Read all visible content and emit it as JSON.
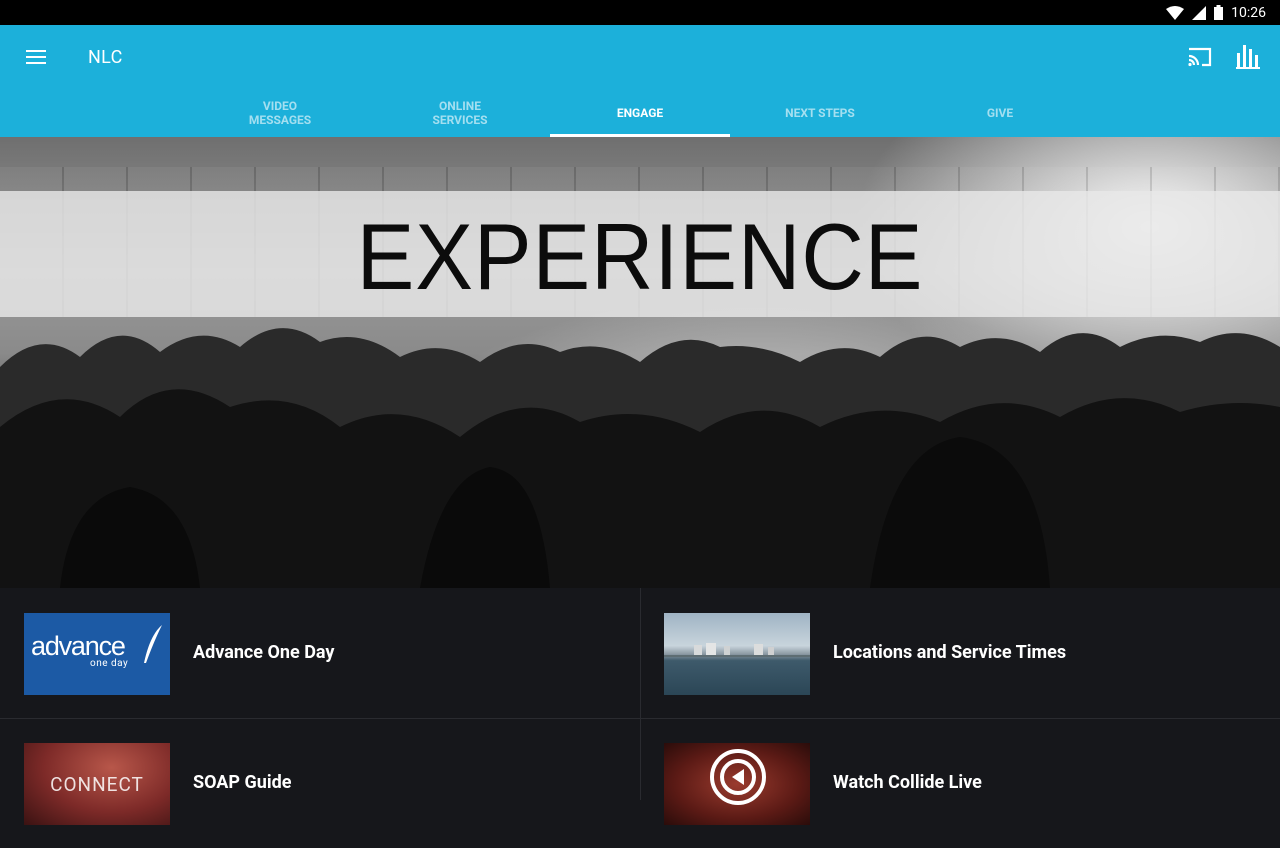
{
  "status_bar": {
    "time": "10:26"
  },
  "app_bar": {
    "title": "NLC"
  },
  "tabs": [
    {
      "line1": "VIDEO",
      "line2": "MESSAGES",
      "active": false
    },
    {
      "line1": "ONLINE",
      "line2": "SERVICES",
      "active": false
    },
    {
      "line1": "ENGAGE",
      "line2": "",
      "active": true
    },
    {
      "line1": "NEXT STEPS",
      "line2": "",
      "active": false
    },
    {
      "line1": "GIVE",
      "line2": "",
      "active": false
    }
  ],
  "hero": {
    "banner_text": "EXPERIENCE"
  },
  "items": [
    {
      "label": "Advance One Day",
      "thumb_text": "advance",
      "thumb_sub": "one day"
    },
    {
      "label": "Locations and Service Times"
    },
    {
      "label": "SOAP Guide",
      "thumb_text": "CONNECT"
    },
    {
      "label": "Watch Collide Live"
    }
  ],
  "colors": {
    "app_bar": "#1cb0da",
    "list_bg": "#16171b",
    "status_bar": "#000000"
  },
  "icons": [
    "menu-icon",
    "cast-icon",
    "stats-icon",
    "wifi-icon",
    "signal-icon",
    "battery-icon"
  ]
}
